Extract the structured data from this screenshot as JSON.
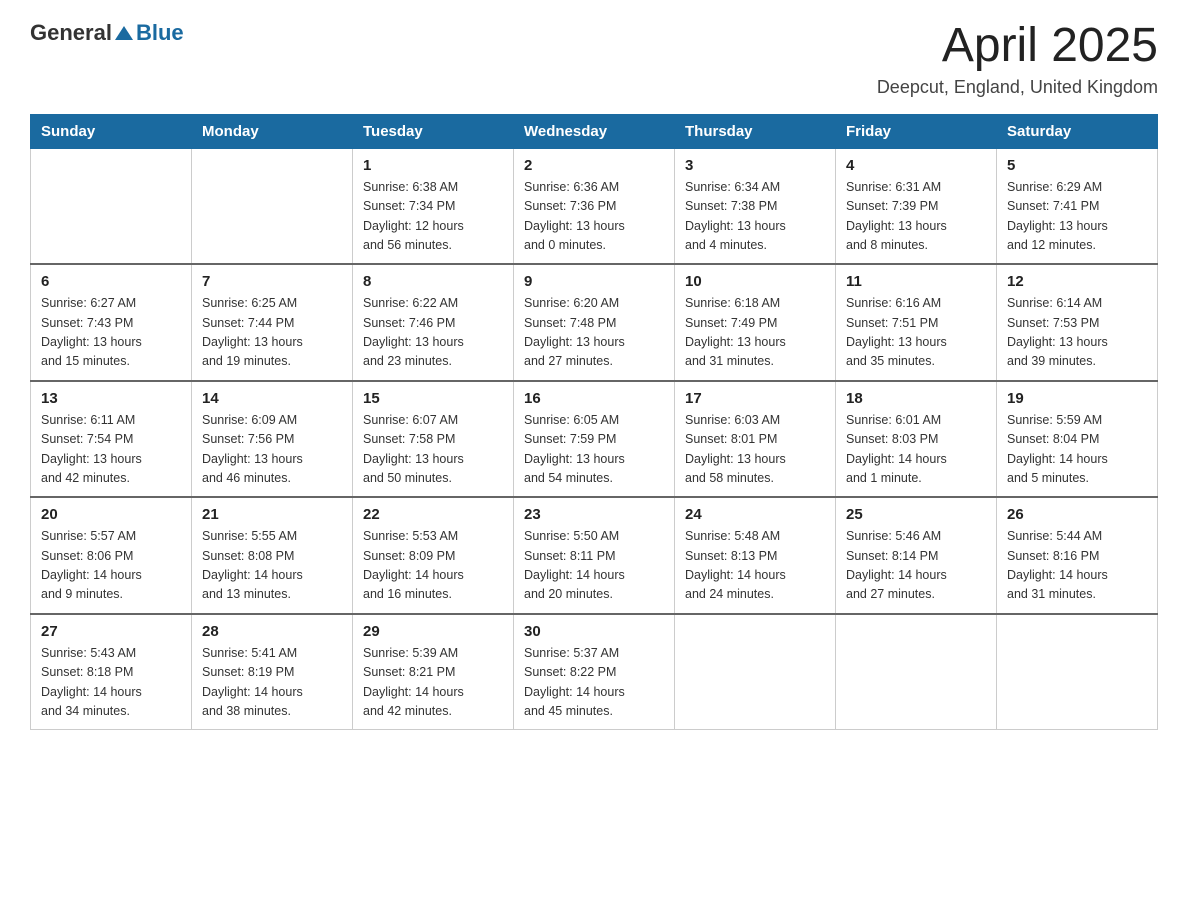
{
  "logo": {
    "general": "General",
    "blue": "Blue"
  },
  "header": {
    "title": "April 2025",
    "location": "Deepcut, England, United Kingdom"
  },
  "days_of_week": [
    "Sunday",
    "Monday",
    "Tuesday",
    "Wednesday",
    "Thursday",
    "Friday",
    "Saturday"
  ],
  "weeks": [
    [
      {
        "day": "",
        "info": ""
      },
      {
        "day": "",
        "info": ""
      },
      {
        "day": "1",
        "info": "Sunrise: 6:38 AM\nSunset: 7:34 PM\nDaylight: 12 hours\nand 56 minutes."
      },
      {
        "day": "2",
        "info": "Sunrise: 6:36 AM\nSunset: 7:36 PM\nDaylight: 13 hours\nand 0 minutes."
      },
      {
        "day": "3",
        "info": "Sunrise: 6:34 AM\nSunset: 7:38 PM\nDaylight: 13 hours\nand 4 minutes."
      },
      {
        "day": "4",
        "info": "Sunrise: 6:31 AM\nSunset: 7:39 PM\nDaylight: 13 hours\nand 8 minutes."
      },
      {
        "day": "5",
        "info": "Sunrise: 6:29 AM\nSunset: 7:41 PM\nDaylight: 13 hours\nand 12 minutes."
      }
    ],
    [
      {
        "day": "6",
        "info": "Sunrise: 6:27 AM\nSunset: 7:43 PM\nDaylight: 13 hours\nand 15 minutes."
      },
      {
        "day": "7",
        "info": "Sunrise: 6:25 AM\nSunset: 7:44 PM\nDaylight: 13 hours\nand 19 minutes."
      },
      {
        "day": "8",
        "info": "Sunrise: 6:22 AM\nSunset: 7:46 PM\nDaylight: 13 hours\nand 23 minutes."
      },
      {
        "day": "9",
        "info": "Sunrise: 6:20 AM\nSunset: 7:48 PM\nDaylight: 13 hours\nand 27 minutes."
      },
      {
        "day": "10",
        "info": "Sunrise: 6:18 AM\nSunset: 7:49 PM\nDaylight: 13 hours\nand 31 minutes."
      },
      {
        "day": "11",
        "info": "Sunrise: 6:16 AM\nSunset: 7:51 PM\nDaylight: 13 hours\nand 35 minutes."
      },
      {
        "day": "12",
        "info": "Sunrise: 6:14 AM\nSunset: 7:53 PM\nDaylight: 13 hours\nand 39 minutes."
      }
    ],
    [
      {
        "day": "13",
        "info": "Sunrise: 6:11 AM\nSunset: 7:54 PM\nDaylight: 13 hours\nand 42 minutes."
      },
      {
        "day": "14",
        "info": "Sunrise: 6:09 AM\nSunset: 7:56 PM\nDaylight: 13 hours\nand 46 minutes."
      },
      {
        "day": "15",
        "info": "Sunrise: 6:07 AM\nSunset: 7:58 PM\nDaylight: 13 hours\nand 50 minutes."
      },
      {
        "day": "16",
        "info": "Sunrise: 6:05 AM\nSunset: 7:59 PM\nDaylight: 13 hours\nand 54 minutes."
      },
      {
        "day": "17",
        "info": "Sunrise: 6:03 AM\nSunset: 8:01 PM\nDaylight: 13 hours\nand 58 minutes."
      },
      {
        "day": "18",
        "info": "Sunrise: 6:01 AM\nSunset: 8:03 PM\nDaylight: 14 hours\nand 1 minute."
      },
      {
        "day": "19",
        "info": "Sunrise: 5:59 AM\nSunset: 8:04 PM\nDaylight: 14 hours\nand 5 minutes."
      }
    ],
    [
      {
        "day": "20",
        "info": "Sunrise: 5:57 AM\nSunset: 8:06 PM\nDaylight: 14 hours\nand 9 minutes."
      },
      {
        "day": "21",
        "info": "Sunrise: 5:55 AM\nSunset: 8:08 PM\nDaylight: 14 hours\nand 13 minutes."
      },
      {
        "day": "22",
        "info": "Sunrise: 5:53 AM\nSunset: 8:09 PM\nDaylight: 14 hours\nand 16 minutes."
      },
      {
        "day": "23",
        "info": "Sunrise: 5:50 AM\nSunset: 8:11 PM\nDaylight: 14 hours\nand 20 minutes."
      },
      {
        "day": "24",
        "info": "Sunrise: 5:48 AM\nSunset: 8:13 PM\nDaylight: 14 hours\nand 24 minutes."
      },
      {
        "day": "25",
        "info": "Sunrise: 5:46 AM\nSunset: 8:14 PM\nDaylight: 14 hours\nand 27 minutes."
      },
      {
        "day": "26",
        "info": "Sunrise: 5:44 AM\nSunset: 8:16 PM\nDaylight: 14 hours\nand 31 minutes."
      }
    ],
    [
      {
        "day": "27",
        "info": "Sunrise: 5:43 AM\nSunset: 8:18 PM\nDaylight: 14 hours\nand 34 minutes."
      },
      {
        "day": "28",
        "info": "Sunrise: 5:41 AM\nSunset: 8:19 PM\nDaylight: 14 hours\nand 38 minutes."
      },
      {
        "day": "29",
        "info": "Sunrise: 5:39 AM\nSunset: 8:21 PM\nDaylight: 14 hours\nand 42 minutes."
      },
      {
        "day": "30",
        "info": "Sunrise: 5:37 AM\nSunset: 8:22 PM\nDaylight: 14 hours\nand 45 minutes."
      },
      {
        "day": "",
        "info": ""
      },
      {
        "day": "",
        "info": ""
      },
      {
        "day": "",
        "info": ""
      }
    ]
  ]
}
